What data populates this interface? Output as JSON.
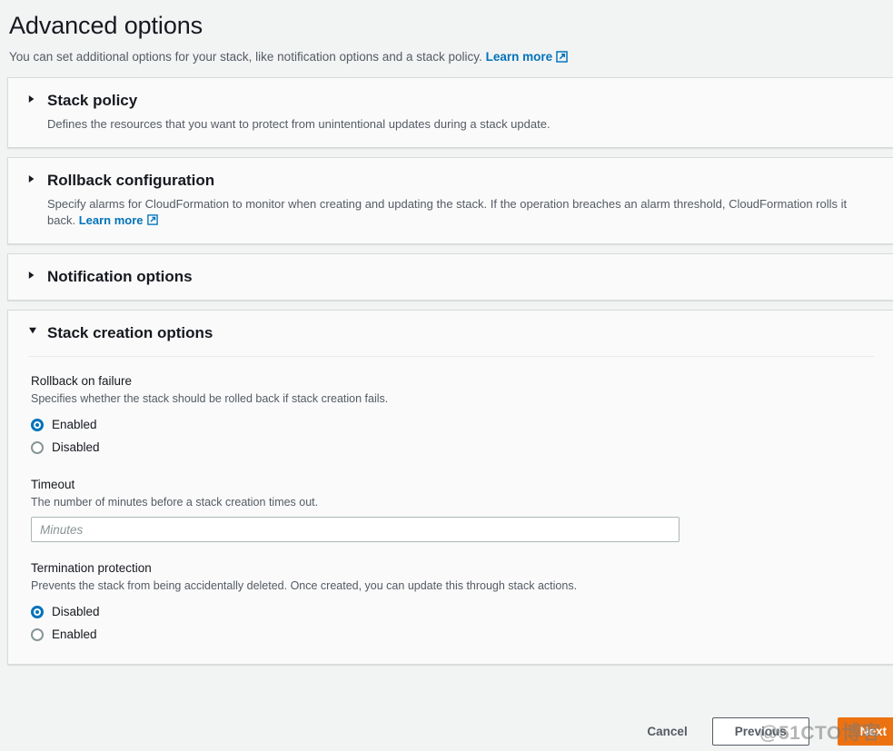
{
  "page": {
    "title": "Advanced options",
    "description": "You can set additional options for your stack, like notification options and a stack policy.",
    "learn_more_label": "Learn more",
    "learn_more_icon": "external-link-icon"
  },
  "colors": {
    "page_background": "#f2f3f3",
    "panel_background": "#fafafa",
    "link": "#0073bb",
    "radio_selected": "#0073bb",
    "primary_button": "#ec7211",
    "text_primary": "#16191f",
    "text_secondary": "#545b64",
    "border": "#d5dbdb"
  },
  "sections": [
    {
      "id": "stack-policy",
      "title": "Stack policy",
      "expanded": false,
      "caret_icon": "triangle-right-icon",
      "description": "Defines the resources that you want to protect from unintentional updates during a stack update.",
      "has_learn_more": false
    },
    {
      "id": "rollback-configuration",
      "title": "Rollback configuration",
      "expanded": false,
      "caret_icon": "triangle-right-icon",
      "description": "Specify alarms for CloudFormation to monitor when creating and updating the stack. If the operation breaches an alarm threshold, CloudFormation rolls it back.",
      "has_learn_more": true,
      "learn_more_label": "Learn more"
    },
    {
      "id": "notification-options",
      "title": "Notification options",
      "expanded": false,
      "caret_icon": "triangle-right-icon",
      "description": "",
      "has_learn_more": false
    },
    {
      "id": "stack-creation-options",
      "title": "Stack creation options",
      "expanded": true,
      "caret_icon": "triangle-down-icon",
      "description": "",
      "has_learn_more": false
    }
  ],
  "stack_creation_options": {
    "rollback_on_failure": {
      "label": "Rollback on failure",
      "hint": "Specifies whether the stack should be rolled back if stack creation fails.",
      "options": [
        {
          "label": "Enabled",
          "selected": true
        },
        {
          "label": "Disabled",
          "selected": false
        }
      ]
    },
    "timeout": {
      "label": "Timeout",
      "hint": "The number of minutes before a stack creation times out.",
      "value": "",
      "placeholder": "Minutes"
    },
    "termination_protection": {
      "label": "Termination protection",
      "hint": "Prevents the stack from being accidentally deleted. Once created, you can update this through stack actions.",
      "options": [
        {
          "label": "Disabled",
          "selected": true
        },
        {
          "label": "Enabled",
          "selected": false
        }
      ]
    }
  },
  "footer": {
    "cancel_label": "Cancel",
    "previous_label": "Previous",
    "next_label": "Next"
  },
  "watermark": {
    "text": "@51CTO博客"
  }
}
